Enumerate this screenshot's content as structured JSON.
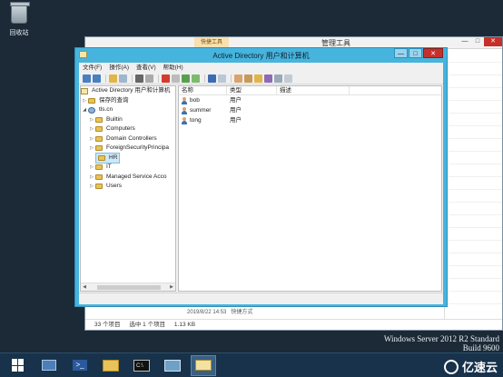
{
  "desktop": {
    "recycle_bin_label": "回收站"
  },
  "server_manager": {
    "tool_tab": "快捷工具",
    "title": "管理工具",
    "controls": {
      "minimize": "—",
      "maximize": "□",
      "close": "✕"
    },
    "partial_row": "2019/8/22 14:53",
    "partial_row_type": "快捷方式",
    "status": {
      "count": "33 个项目",
      "selected": "选中 1 个项目",
      "size": "1.13 KB"
    }
  },
  "aduc": {
    "title": "Active Directory 用户和计算机",
    "controls": {
      "minimize": "—",
      "maximize": "□",
      "close": "✕"
    },
    "menu": [
      "文件(F)",
      "操作(A)",
      "查看(V)",
      "帮助(H)"
    ],
    "tree": {
      "root": "Active Directory 用户和计算机",
      "saved_queries": "保存的查询",
      "domain": "tls.cn",
      "children": [
        "Builtin",
        "Computers",
        "Domain Controllers",
        "ForeignSecurityPrincipa",
        "HR",
        "IT",
        "Managed Service Acco",
        "Users"
      ],
      "selected": "HR"
    },
    "list": {
      "columns": [
        "名称",
        "类型",
        "描述"
      ],
      "rows": [
        {
          "name": "bob",
          "type": "用户"
        },
        {
          "name": "summer",
          "type": "用户"
        },
        {
          "name": "tong",
          "type": "用户"
        }
      ]
    }
  },
  "watermark": {
    "os": "Windows Server 2012 R2 Standard",
    "build": "Build 9600"
  },
  "taskbar": {
    "brand": "亿速云"
  }
}
